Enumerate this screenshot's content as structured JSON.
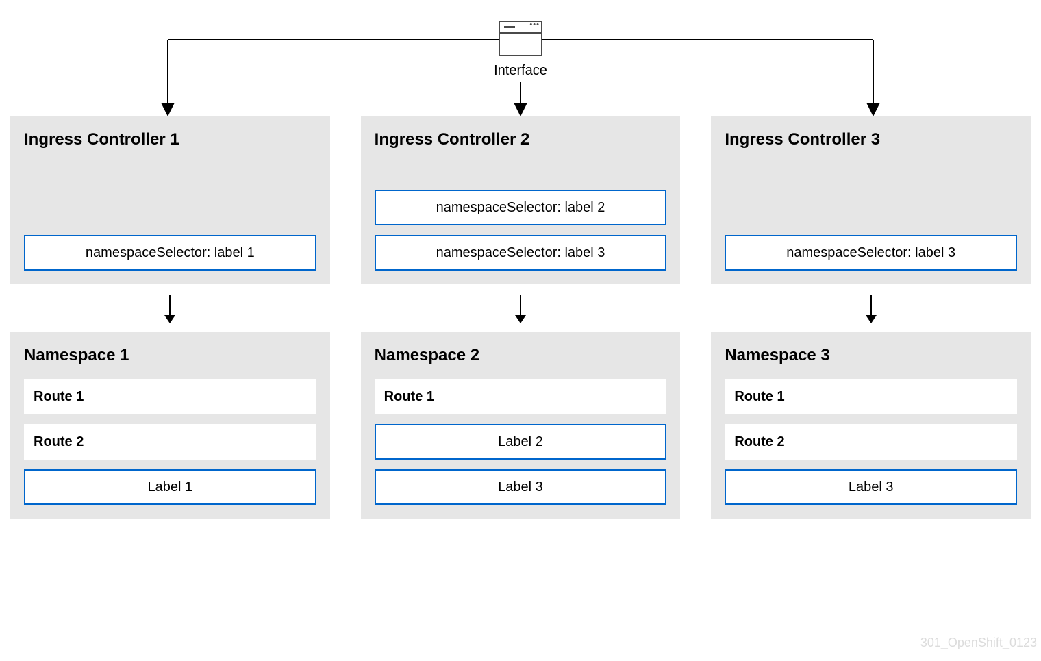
{
  "interface": {
    "label": "Interface"
  },
  "columns": [
    {
      "controller_title": "Ingress Controller 1",
      "selectors": [
        "namespaceSelector: label 1"
      ],
      "namespace_title": "Namespace 1",
      "items": [
        {
          "type": "route",
          "text": "Route 1"
        },
        {
          "type": "route",
          "text": "Route 2"
        },
        {
          "type": "label",
          "text": "Label 1"
        }
      ]
    },
    {
      "controller_title": "Ingress Controller 2",
      "selectors": [
        "namespaceSelector: label 2",
        "namespaceSelector: label 3"
      ],
      "namespace_title": "Namespace 2",
      "items": [
        {
          "type": "route",
          "text": "Route 1"
        },
        {
          "type": "label",
          "text": "Label 2"
        },
        {
          "type": "label",
          "text": "Label 3"
        }
      ]
    },
    {
      "controller_title": "Ingress Controller 3",
      "selectors": [
        "namespaceSelector: label 3"
      ],
      "namespace_title": "Namespace 3",
      "items": [
        {
          "type": "route",
          "text": "Route 1"
        },
        {
          "type": "route",
          "text": "Route 2"
        },
        {
          "type": "label",
          "text": "Label 3"
        }
      ]
    }
  ],
  "watermark": "301_OpenShift_0123"
}
